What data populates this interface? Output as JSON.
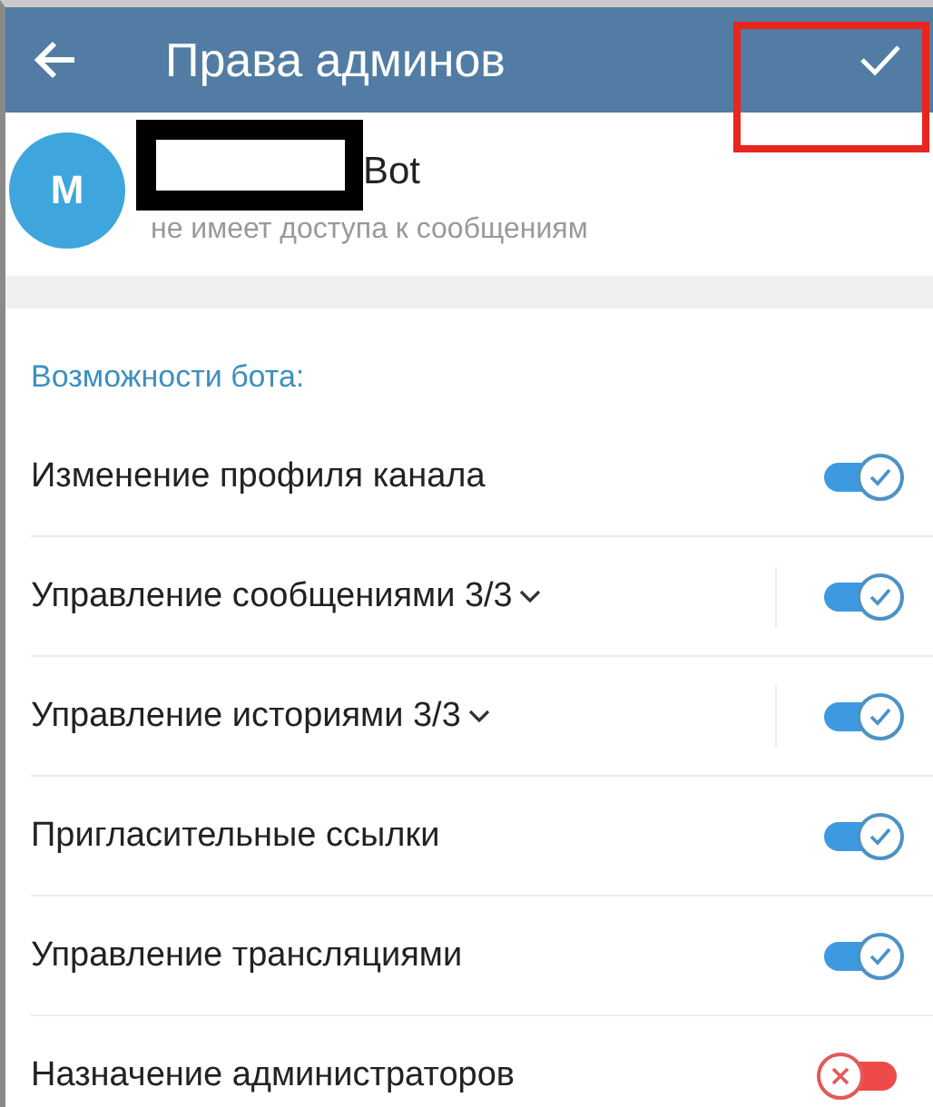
{
  "header": {
    "title": "Права админов"
  },
  "profile": {
    "avatar_letter": "M",
    "name_visible": "Bot",
    "status": "не имеет доступа к сообщениям"
  },
  "section": {
    "title": "Возможности бота:"
  },
  "permissions": [
    {
      "kind": "toggle",
      "label": "Изменение профиля канала",
      "on": true
    },
    {
      "kind": "expandable",
      "label": "Управление сообщениями 3/3",
      "on": true
    },
    {
      "kind": "expandable",
      "label": "Управление историями 3/3",
      "on": true
    },
    {
      "kind": "toggle",
      "label": "Пригласительные ссылки",
      "on": true
    },
    {
      "kind": "toggle",
      "label": "Управление трансляциями",
      "on": true
    },
    {
      "kind": "toggle",
      "label": "Назначение администраторов",
      "on": false
    }
  ]
}
